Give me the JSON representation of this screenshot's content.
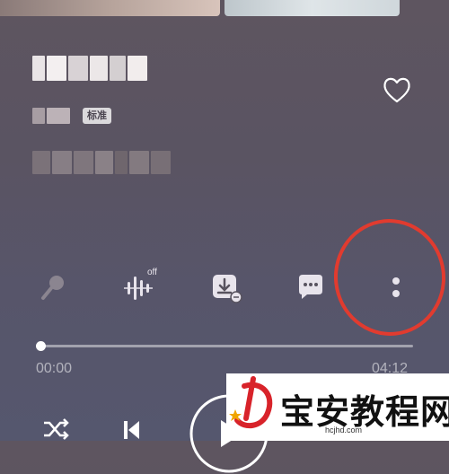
{
  "song": {
    "quality_badge": "标准"
  },
  "controls": [
    {
      "name": "sing-mic-icon"
    },
    {
      "name": "audio-effect-icon",
      "label": "off"
    },
    {
      "name": "download-icon"
    },
    {
      "name": "comment-icon"
    },
    {
      "name": "more-options-icon"
    }
  ],
  "playback": {
    "elapsed": "00:00",
    "total": "04:12",
    "progress": 0
  },
  "watermark": {
    "title": "宝安教程网",
    "url": "hcjhd.com"
  },
  "colors": {
    "annotation_circle": "#e13b2f"
  }
}
